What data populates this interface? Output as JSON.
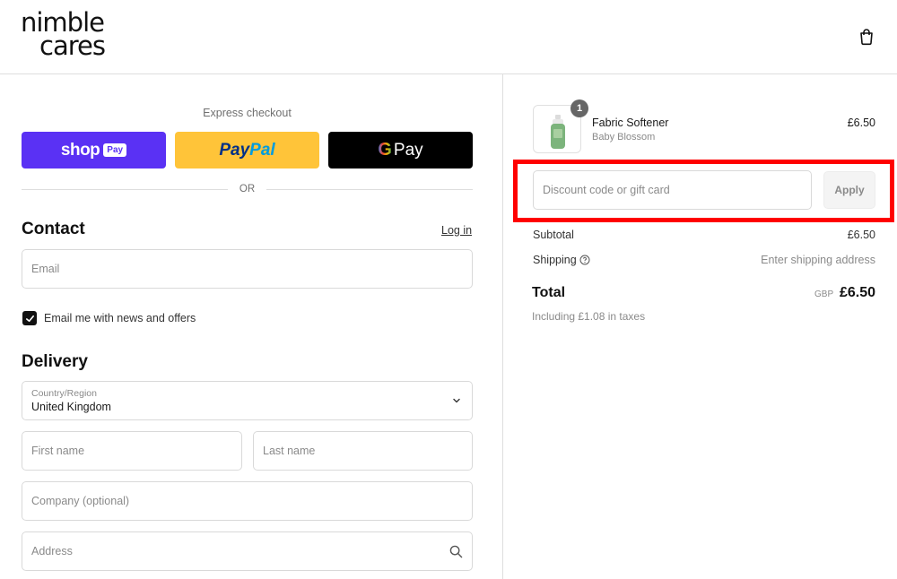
{
  "header": {
    "logo_line1": "nimble",
    "logo_line2": "cares",
    "cart_icon": "shopping-bag-icon"
  },
  "express": {
    "label": "Express checkout",
    "shop_pay": {
      "word": "shop",
      "badge": "Pay",
      "color": "#5a31f4"
    },
    "paypal": {
      "part1": "Pay",
      "part2": "Pal",
      "color": "#ffc439"
    },
    "gpay": {
      "g": "G",
      "pay": "Pay",
      "color": "#000000"
    },
    "or_text": "OR"
  },
  "contact": {
    "title": "Contact",
    "login_link": "Log in",
    "email_placeholder": "Email",
    "newsletter_label": "Email me with news and offers",
    "newsletter_checked": true
  },
  "delivery": {
    "title": "Delivery",
    "country_label": "Country/Region",
    "country_value": "United Kingdom",
    "first_name_placeholder": "First name",
    "last_name_placeholder": "Last name",
    "company_placeholder": "Company (optional)",
    "address_placeholder": "Address"
  },
  "order": {
    "item": {
      "quantity": "1",
      "name": "Fabric Softener",
      "variant": "Baby Blossom",
      "price": "£6.50"
    },
    "discount": {
      "placeholder": "Discount code or gift card",
      "apply_label": "Apply"
    },
    "subtotal_label": "Subtotal",
    "subtotal_value": "£6.50",
    "shipping_label": "Shipping",
    "shipping_value": "Enter shipping address",
    "total_label": "Total",
    "total_currency": "GBP",
    "total_value": "£6.50",
    "tax_note": "Including £1.08 in taxes"
  },
  "colors": {
    "highlight": "#ff0000"
  }
}
